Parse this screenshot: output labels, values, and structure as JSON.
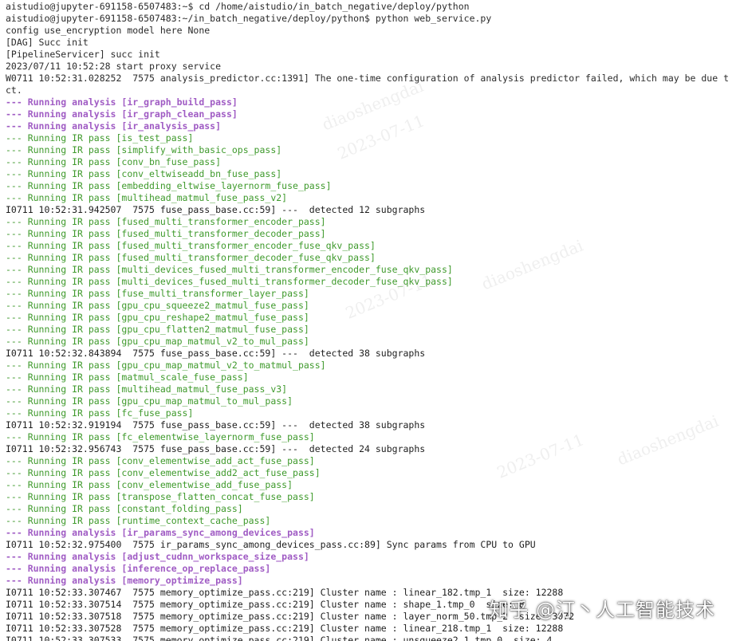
{
  "terminal": {
    "lines": [
      {
        "style": "plain",
        "text": "aistudio@jupyter-691158-6507483:~$ cd /home/aistudio/in_batch_negative/deploy/python"
      },
      {
        "style": "plain",
        "text": "aistudio@jupyter-691158-6507483:~/in_batch_negative/deploy/python$ python web_service.py"
      },
      {
        "style": "plain",
        "text": "config use_encryption model here None"
      },
      {
        "style": "plain",
        "text": "[DAG] Succ init"
      },
      {
        "style": "plain",
        "text": "[PipelineServicer] succ init"
      },
      {
        "style": "plain",
        "text": "2023/07/11 10:52:28 start proxy service"
      },
      {
        "style": "plain",
        "text": "W0711 10:52:31.028252  7575 analysis_predictor.cc:1391] The one-time configuration of analysis predictor failed, which may be due t"
      },
      {
        "style": "plain",
        "text": "ct."
      },
      {
        "style": "analysis",
        "text": "--- Running analysis [ir_graph_build_pass]"
      },
      {
        "style": "analysis",
        "text": "--- Running analysis [ir_graph_clean_pass]"
      },
      {
        "style": "analysis",
        "text": "--- Running analysis [ir_analysis_pass]"
      },
      {
        "style": "ir",
        "text": "--- Running IR pass [is_test_pass]"
      },
      {
        "style": "ir",
        "text": "--- Running IR pass [simplify_with_basic_ops_pass]"
      },
      {
        "style": "ir",
        "text": "--- Running IR pass [conv_bn_fuse_pass]"
      },
      {
        "style": "ir",
        "text": "--- Running IR pass [conv_eltwiseadd_bn_fuse_pass]"
      },
      {
        "style": "ir",
        "text": "--- Running IR pass [embedding_eltwise_layernorm_fuse_pass]"
      },
      {
        "style": "ir",
        "text": "--- Running IR pass [multihead_matmul_fuse_pass_v2]"
      },
      {
        "style": "info",
        "text": "I0711 10:52:31.942507  7575 fuse_pass_base.cc:59] ---  detected 12 subgraphs"
      },
      {
        "style": "ir",
        "text": "--- Running IR pass [fused_multi_transformer_encoder_pass]"
      },
      {
        "style": "ir",
        "text": "--- Running IR pass [fused_multi_transformer_decoder_pass]"
      },
      {
        "style": "ir",
        "text": "--- Running IR pass [fused_multi_transformer_encoder_fuse_qkv_pass]"
      },
      {
        "style": "ir",
        "text": "--- Running IR pass [fused_multi_transformer_decoder_fuse_qkv_pass]"
      },
      {
        "style": "ir",
        "text": "--- Running IR pass [multi_devices_fused_multi_transformer_encoder_fuse_qkv_pass]"
      },
      {
        "style": "ir",
        "text": "--- Running IR pass [multi_devices_fused_multi_transformer_decoder_fuse_qkv_pass]"
      },
      {
        "style": "ir",
        "text": "--- Running IR pass [fuse_multi_transformer_layer_pass]"
      },
      {
        "style": "ir",
        "text": "--- Running IR pass [gpu_cpu_squeeze2_matmul_fuse_pass]"
      },
      {
        "style": "ir",
        "text": "--- Running IR pass [gpu_cpu_reshape2_matmul_fuse_pass]"
      },
      {
        "style": "ir",
        "text": "--- Running IR pass [gpu_cpu_flatten2_matmul_fuse_pass]"
      },
      {
        "style": "ir",
        "text": "--- Running IR pass [gpu_cpu_map_matmul_v2_to_mul_pass]"
      },
      {
        "style": "info",
        "text": "I0711 10:52:32.843894  7575 fuse_pass_base.cc:59] ---  detected 38 subgraphs"
      },
      {
        "style": "ir",
        "text": "--- Running IR pass [gpu_cpu_map_matmul_v2_to_matmul_pass]"
      },
      {
        "style": "ir",
        "text": "--- Running IR pass [matmul_scale_fuse_pass]"
      },
      {
        "style": "ir",
        "text": "--- Running IR pass [multihead_matmul_fuse_pass_v3]"
      },
      {
        "style": "ir",
        "text": "--- Running IR pass [gpu_cpu_map_matmul_to_mul_pass]"
      },
      {
        "style": "ir",
        "text": "--- Running IR pass [fc_fuse_pass]"
      },
      {
        "style": "info",
        "text": "I0711 10:52:32.919194  7575 fuse_pass_base.cc:59] ---  detected 38 subgraphs"
      },
      {
        "style": "ir",
        "text": "--- Running IR pass [fc_elementwise_layernorm_fuse_pass]"
      },
      {
        "style": "info",
        "text": "I0711 10:52:32.956743  7575 fuse_pass_base.cc:59] ---  detected 24 subgraphs"
      },
      {
        "style": "ir",
        "text": "--- Running IR pass [conv_elementwise_add_act_fuse_pass]"
      },
      {
        "style": "ir",
        "text": "--- Running IR pass [conv_elementwise_add2_act_fuse_pass]"
      },
      {
        "style": "ir",
        "text": "--- Running IR pass [conv_elementwise_add_fuse_pass]"
      },
      {
        "style": "ir",
        "text": "--- Running IR pass [transpose_flatten_concat_fuse_pass]"
      },
      {
        "style": "ir",
        "text": "--- Running IR pass [constant_folding_pass]"
      },
      {
        "style": "ir",
        "text": "--- Running IR pass [runtime_context_cache_pass]"
      },
      {
        "style": "analysis",
        "text": "--- Running analysis [ir_params_sync_among_devices_pass]"
      },
      {
        "style": "info",
        "text": "I0711 10:52:32.975400  7575 ir_params_sync_among_devices_pass.cc:89] Sync params from CPU to GPU"
      },
      {
        "style": "analysis",
        "text": "--- Running analysis [adjust_cudnn_workspace_size_pass]"
      },
      {
        "style": "analysis",
        "text": "--- Running analysis [inference_op_replace_pass]"
      },
      {
        "style": "analysis",
        "text": "--- Running analysis [memory_optimize_pass]"
      },
      {
        "style": "info",
        "text": "I0711 10:52:33.307467  7575 memory_optimize_pass.cc:219] Cluster name : linear_182.tmp_1  size: 12288"
      },
      {
        "style": "info",
        "text": "I0711 10:52:33.307514  7575 memory_optimize_pass.cc:219] Cluster name : shape_1.tmp_0  size: 8"
      },
      {
        "style": "info",
        "text": "I0711 10:52:33.307518  7575 memory_optimize_pass.cc:219] Cluster name : layer_norm_50.tmp_2  size: 3072"
      },
      {
        "style": "info",
        "text": "I0711 10:52:33.307528  7575 memory_optimize_pass.cc:219] Cluster name : linear_218.tmp_1  size: 12288"
      },
      {
        "style": "info",
        "text": "I0711 10:52:33.307533  7575 memory_optimize_pass.cc:219] Cluster name : unsqueeze2_1.tmp_0  size: 4"
      }
    ]
  },
  "watermarks": [
    "diaoshengdai",
    "2023-07-11",
    "diaoshengdai",
    "2023-07-11",
    "diaoshengdai",
    "2023-07-11"
  ],
  "brand": {
    "text": "知乎 @汀丶人工智能技术"
  }
}
